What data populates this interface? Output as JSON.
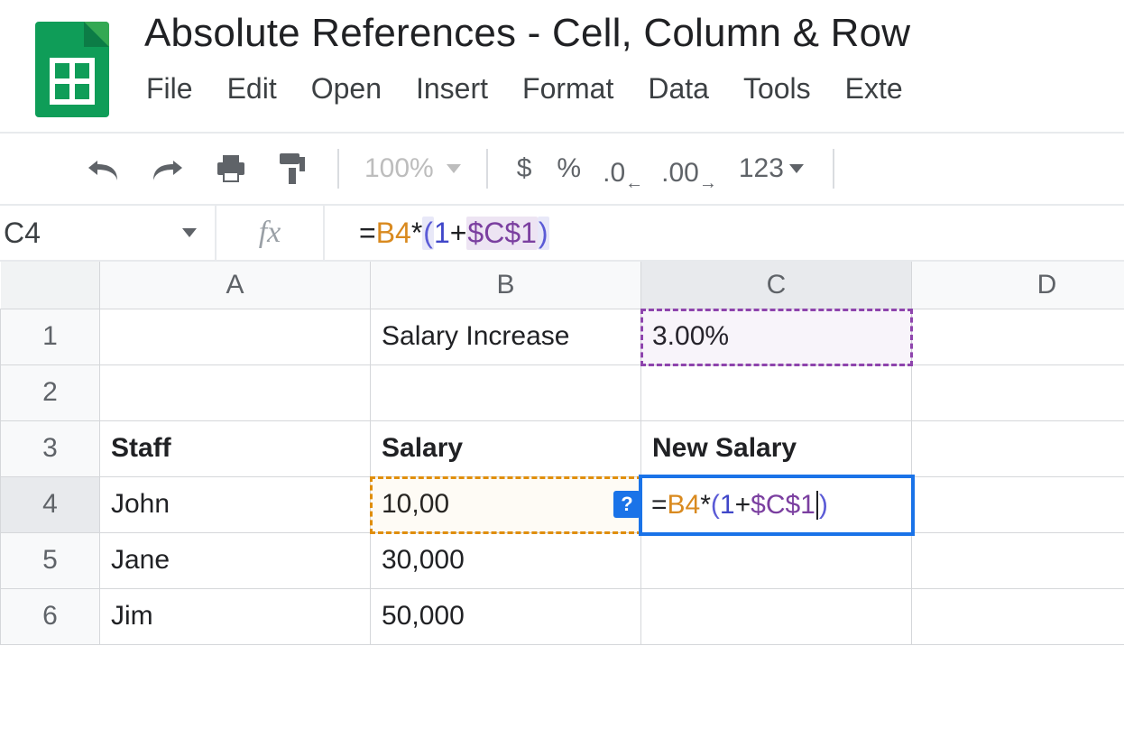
{
  "doc": {
    "title": "Absolute References - Cell, Column & Row"
  },
  "menu": {
    "file": "File",
    "edit": "Edit",
    "open": "Open",
    "insert": "Insert",
    "format": "Format",
    "data": "Data",
    "tools": "Tools",
    "extensions": "Exte"
  },
  "toolbar": {
    "zoom": "100%",
    "currency": "$",
    "percent": "%",
    "dec0": ".0",
    "dec00": ".00",
    "numfmt": "123"
  },
  "fx": {
    "namebox": "C4",
    "symbol": "fx",
    "formula_tokens": {
      "eq": "=",
      "ref1": "B4",
      "star": "*",
      "lpar": "(",
      "one": "1",
      "plus": "+",
      "abs": "$C$1",
      "rpar": ")"
    }
  },
  "columns": {
    "A": "A",
    "B": "B",
    "C": "C",
    "D": "D"
  },
  "rows": {
    "r1": "1",
    "r2": "2",
    "r3": "3",
    "r4": "4",
    "r5": "5",
    "r6": "6"
  },
  "cells": {
    "B1": "Salary Increase",
    "C1": "3.00%",
    "A3": "Staff",
    "B3": "Salary",
    "C3": "New Salary",
    "A4": "John",
    "B4": "10,00",
    "A5": "Jane",
    "B5": "30,000",
    "A6": "Jim",
    "B6": "50,000"
  },
  "edit": {
    "hint": "?",
    "tokens": {
      "eq": "=",
      "ref1": "B4",
      "star": "*",
      "lpar": "(",
      "one": "1",
      "plus": "+",
      "abs": "$C$1",
      "rpar": ")"
    }
  }
}
